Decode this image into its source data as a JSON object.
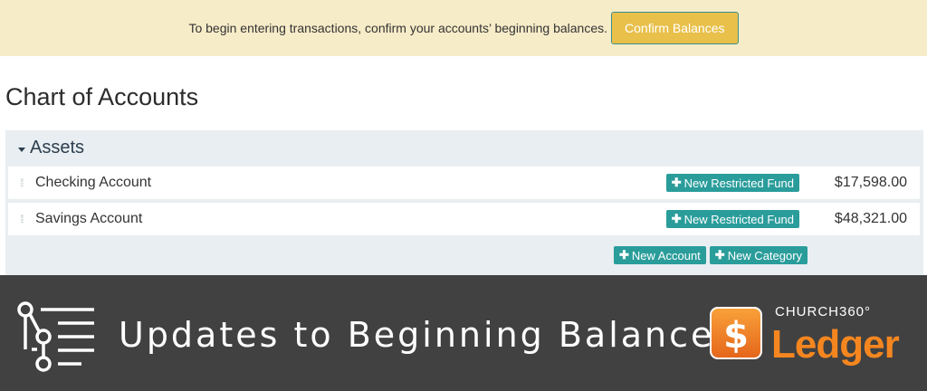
{
  "banner": {
    "message": "To begin entering transactions, confirm your accounts’ beginning balances.",
    "confirm_label": "Confirm Balances"
  },
  "page": {
    "title": "Chart of Accounts"
  },
  "section": {
    "label": "Assets",
    "accounts": [
      {
        "name": "Checking Account",
        "fund_button": "New Restricted Fund",
        "balance": "$17,598.00"
      },
      {
        "name": "Savings Account",
        "fund_button": "New Restricted Fund",
        "balance": "$48,321.00"
      }
    ],
    "new_account_label": "New Account",
    "new_category_label": "New Category"
  },
  "overlay": {
    "title": "Updates to Beginning Balances",
    "brand_small": "CHURCH360°",
    "brand_big": "Ledger",
    "logo_glyph": "$",
    "icon": "timeline-list-icon"
  },
  "colors": {
    "banner_bg": "#f7ecc8",
    "confirm_button": "#e8c04a",
    "teal": "#2a9d9b",
    "overlay_bg": "#414141",
    "brand_orange": "#f5861f"
  }
}
